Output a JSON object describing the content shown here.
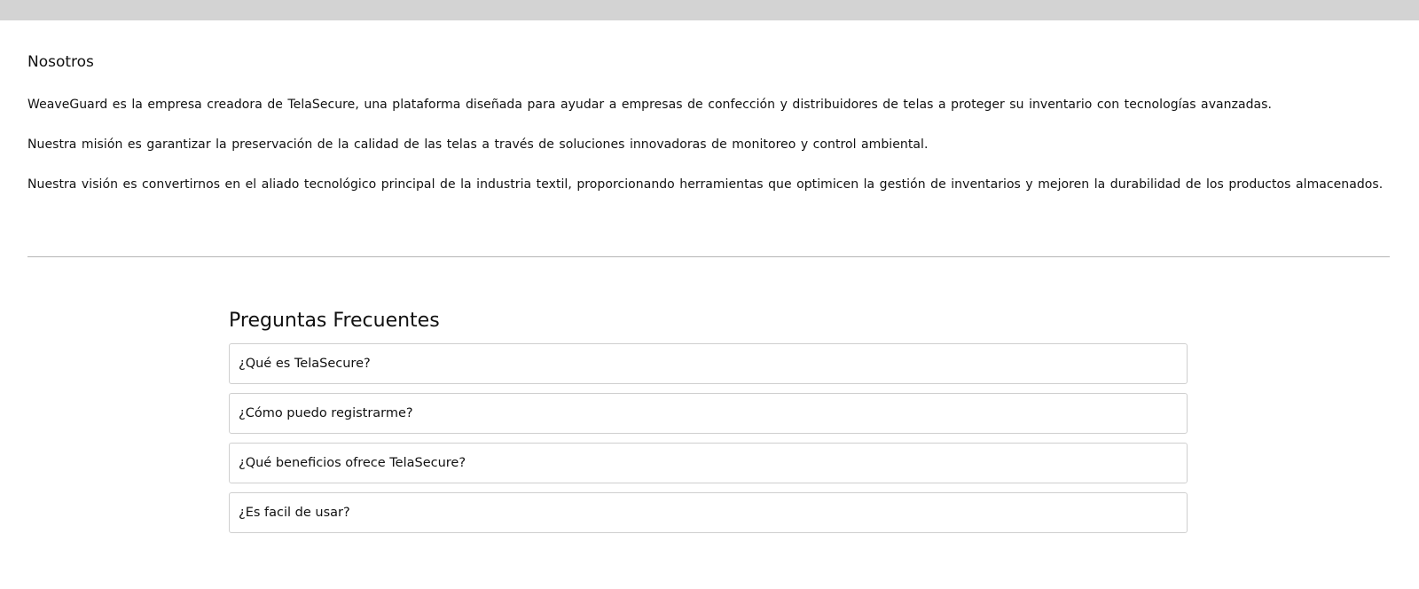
{
  "about": {
    "title": "Nosotros",
    "paragraphs": [
      "WeaveGuard es la empresa creadora de TelaSecure, una plataforma diseñada para ayudar a empresas de confección y distribuidores de telas a proteger su inventario con tecnologías avanzadas.",
      "Nuestra misión es garantizar la preservación de la calidad de las telas a través de soluciones innovadoras de monitoreo y control ambiental.",
      "Nuestra visión es convertirnos en el aliado tecnológico principal de la industria textil, proporcionando herramientas que optimicen la gestión de inventarios y mejoren la durabilidad de los productos almacenados."
    ]
  },
  "faq": {
    "title": "Preguntas Frecuentes",
    "items": [
      "¿Qué es TelaSecure?",
      "¿Cómo puedo registrarme?",
      "¿Qué beneficios ofrece TelaSecure?",
      "¿Es facil de usar?"
    ]
  }
}
